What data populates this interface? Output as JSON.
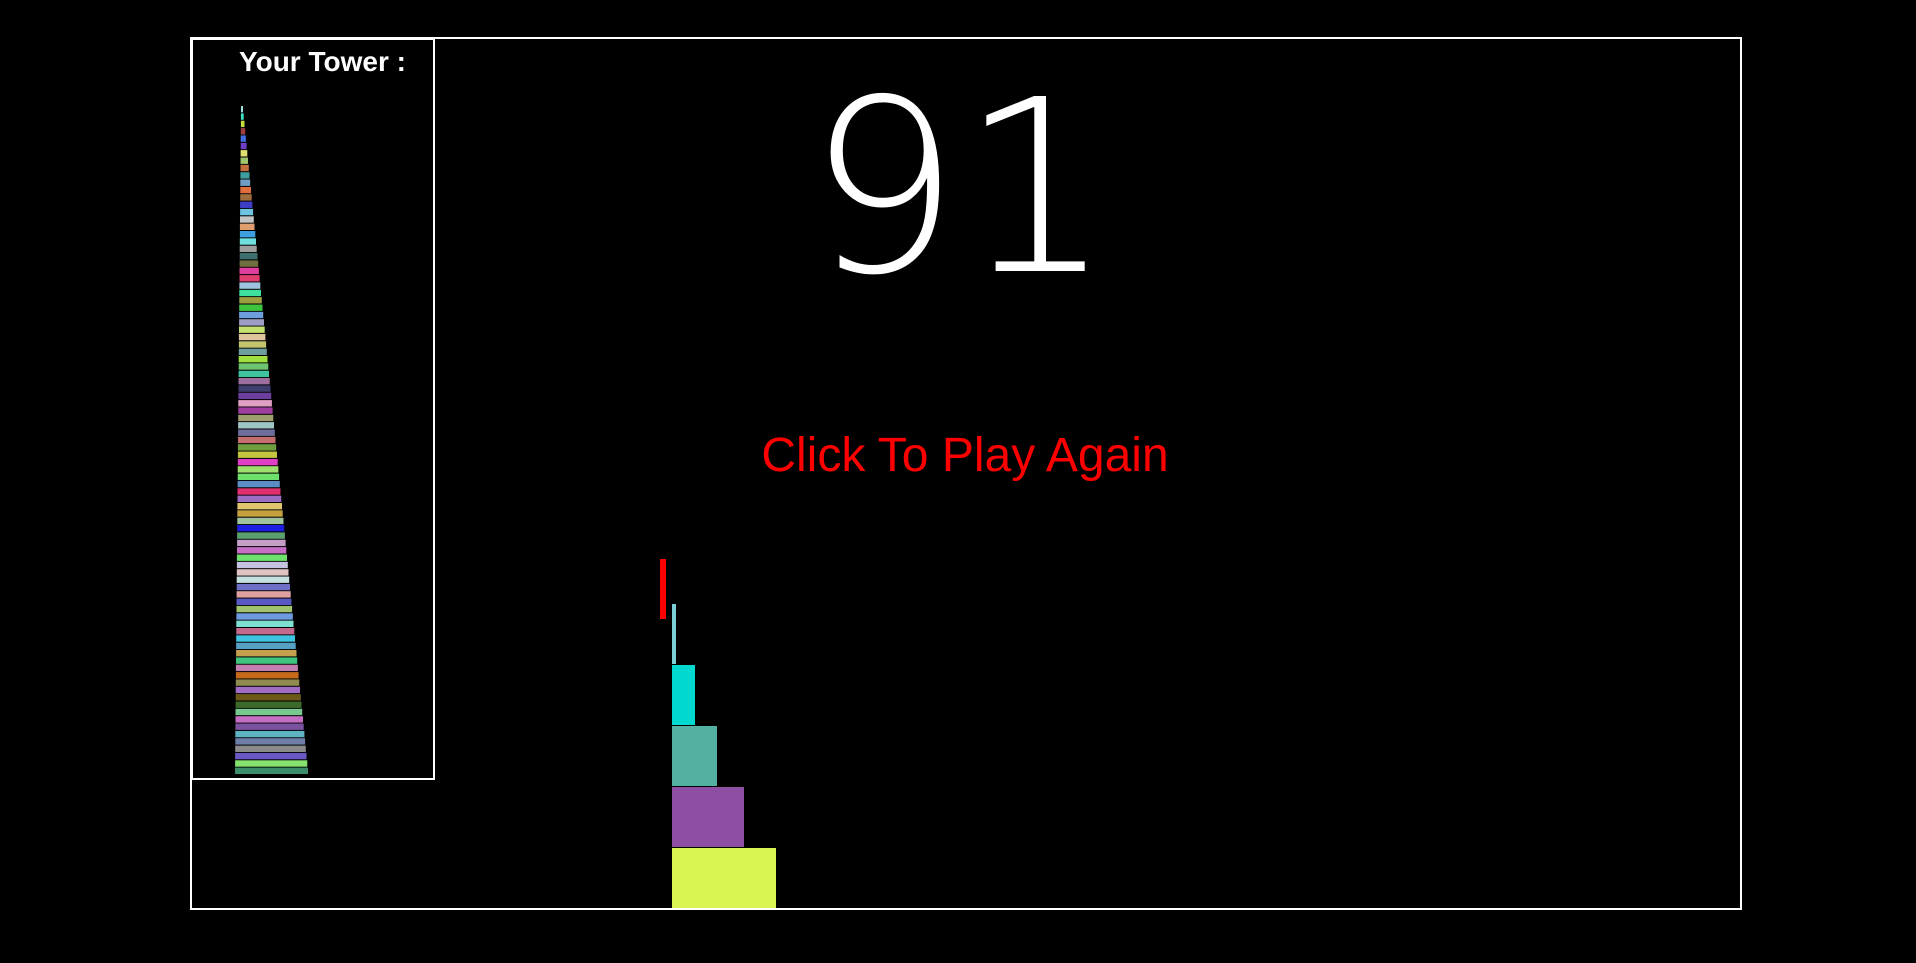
{
  "score": "91",
  "play_again_label": "Click To Play Again",
  "tower_panel": {
    "title": "Your Tower :"
  },
  "colors": {
    "background": "#000000",
    "frame": "#ffffff",
    "play_again": "#ff0000",
    "score": "#ffffff",
    "drop_indicator": "#ff0000"
  },
  "stack_blocks": [
    {
      "color": "#d8f552",
      "width_units": 104
    },
    {
      "color": "#8e4fa3",
      "width_units": 72
    },
    {
      "color": "#54b0a0",
      "width_units": 45
    },
    {
      "color": "#00d8d0",
      "width_units": 23
    },
    {
      "color": "#7ccfd4",
      "width_units": 4
    }
  ],
  "tower_block_colors": [
    "#3b8e69",
    "#86e26f",
    "#6a58c4",
    "#8a8a8a",
    "#6d7ea8",
    "#5fb2c2",
    "#7a52a0",
    "#c46fc4",
    "#78c890",
    "#3b6a2a",
    "#6b5a1a",
    "#a06cc4",
    "#8e8a50",
    "#c46a1a",
    "#c47eb0",
    "#3ec47e",
    "#c4a04f",
    "#56a0c4",
    "#3ec4e0",
    "#c46a8e",
    "#7ee0d0",
    "#6e9ae0",
    "#9ec46e",
    "#5a5ac4",
    "#e0a0a0",
    "#6e6ec4",
    "#c4e0e0",
    "#e0c4c4",
    "#c4c4e0",
    "#6ee06e",
    "#c46ec4",
    "#c49ec4",
    "#5aa06e",
    "#1e1ee0",
    "#9ec49e",
    "#c4a03e",
    "#e0c46e",
    "#9e6ec4",
    "#e0306e",
    "#5a8ec4",
    "#6ee06e",
    "#9ee06e",
    "#e03ec4",
    "#c4c43e",
    "#6e9e3e",
    "#c46e6e",
    "#6e6e9e",
    "#9ec4c4",
    "#9e9e6e",
    "#9e3e9e",
    "#e0a0c4",
    "#6e3e9e",
    "#3e3e6e",
    "#9e6e9e",
    "#3ec49e",
    "#6ec46e",
    "#9ee03e",
    "#6e9e9e",
    "#c4c46e",
    "#e0c49e",
    "#c4e06e",
    "#9e9ec4",
    "#6e9ee0",
    "#3ec43e",
    "#9e9e3e",
    "#3ee09e",
    "#9ec4e0",
    "#e03e6e",
    "#e03e9e",
    "#6e6e3e",
    "#3e6e6e",
    "#9e9e9e",
    "#6ee0e0",
    "#3e9ee0",
    "#e09e6e",
    "#c4c4c4",
    "#6ec4e0",
    "#3e3ec4",
    "#9e6e3e",
    "#e06e3e",
    "#6e9ec4",
    "#3e9e9e",
    "#c46e3e",
    "#9ec46e",
    "#e0e06e",
    "#6e3ec4",
    "#3e6ee0",
    "#9e3e3e",
    "#c4e03e",
    "#3ee0c4",
    "#9ee0e0"
  ]
}
